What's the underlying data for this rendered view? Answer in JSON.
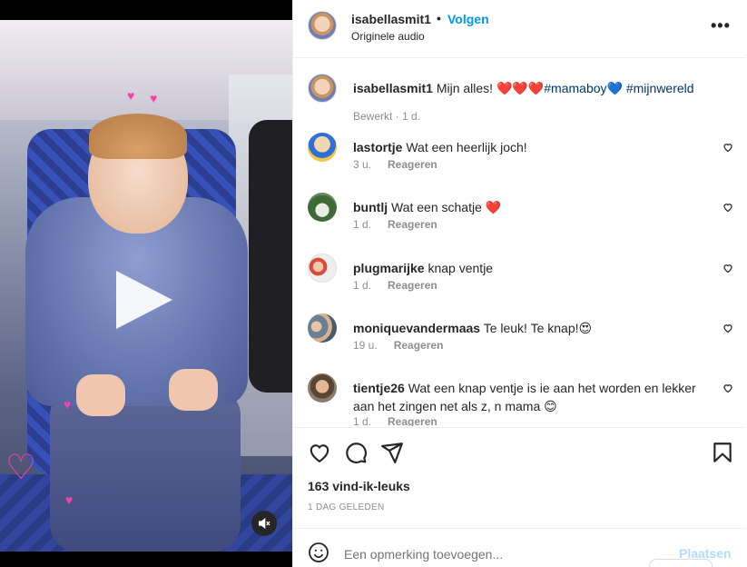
{
  "post": {
    "username": "isabellasmit1",
    "follow_label": "Volgen",
    "audio": "Originele audio",
    "more_icon": "more-horizontal-icon"
  },
  "caption": {
    "username": "isabellasmit1",
    "text": "Mijn alles! ❤️❤️❤️",
    "hashtag1": "#mamaboy",
    "emoji_blue": "💙",
    "hashtag2": "#mijnwereld",
    "meta": "Bewerkt · 1 d."
  },
  "comments": [
    {
      "user": "lastortje",
      "text": "Wat een heerlijk joch!",
      "time": "3 u.",
      "reply": "Reageren"
    },
    {
      "user": "buntlj",
      "text": "Wat een schatje ❤️",
      "time": "1 d.",
      "reply": "Reageren"
    },
    {
      "user": "plugmarijke",
      "text": "knap ventje",
      "time": "1 d.",
      "reply": "Reageren"
    },
    {
      "user": "moniquevandermaas",
      "text": "Te leuk! Te knap!😍",
      "time": "19 u.",
      "reply": "Reageren"
    },
    {
      "user": "tientje26",
      "text": "Wat een knap ventje is ie aan het worden en lekker aan het zingen net als z, n mama 😊",
      "time": "1 d.",
      "reply": "Reageren"
    }
  ],
  "engagement": {
    "likes": "163 vind-ik-leuks",
    "date": "1 DAG GELEDEN"
  },
  "composer": {
    "placeholder": "Een opmerking toevoegen...",
    "post_label": "Plaatsen"
  },
  "colors": {
    "accent": "#0095f6",
    "link": "#00376b",
    "muted": "#8e8e8e",
    "post_disabled": "#b3dbff"
  }
}
